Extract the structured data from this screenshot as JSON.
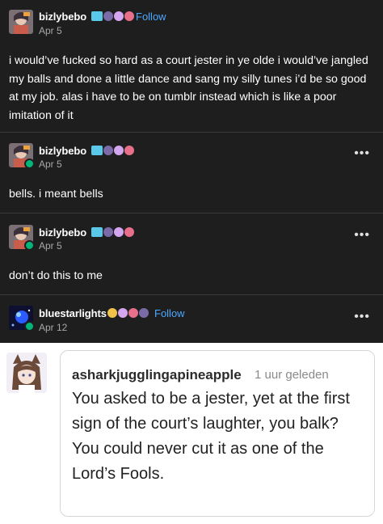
{
  "posts": [
    {
      "username": "bizlybebo",
      "date": "Apr 5",
      "follow": "Follow",
      "more": "•••",
      "body": "i would’ve fucked so hard as a court jester in ye olde i would’ve jangled my balls and done a little dance and sang my silly tunes i’d be so good at my job. alas i have to be on tumblr instead which is like a poor imitation of it"
    },
    {
      "username": "bizlybebo",
      "date": "Apr 5",
      "more": "•••",
      "body": "bells. i meant bells"
    },
    {
      "username": "bizlybebo",
      "date": "Apr 5",
      "more": "•••",
      "body": "don’t do this to me"
    },
    {
      "username": "bluestarlights",
      "date": "Apr 12",
      "follow": "Follow",
      "more": "•••"
    }
  ],
  "comment": {
    "username": "asharkjugglingapineapple",
    "time": "1 uur geleden",
    "line1": "You asked to be a jester, yet at the first sign of the court’s laughter, you balk?",
    "line2": "You could never cut it as one of the Lord’s Fools."
  },
  "colors": {
    "background_dark": "#1e1e1e",
    "follow_link": "#4aa8ff",
    "reblog_badge": "#00b57a"
  }
}
